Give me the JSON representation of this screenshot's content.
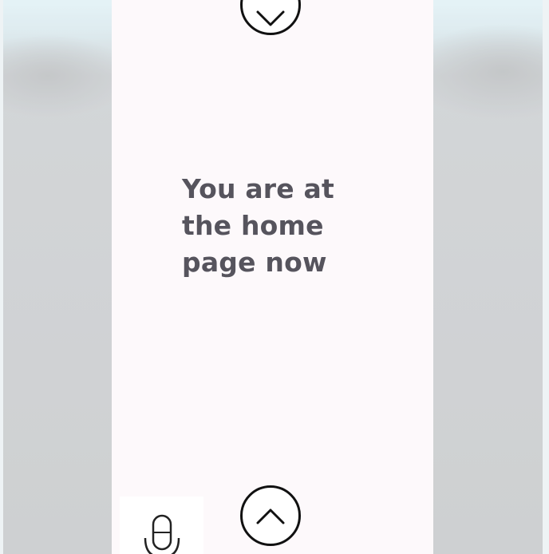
{
  "main": {
    "status_message": "You are at the home page now"
  },
  "controls": {
    "scroll_down_icon": "chevron-down-icon",
    "scroll_up_icon": "chevron-up-icon",
    "voice_icon": "microphone-icon"
  },
  "colors": {
    "panel_background": "#fdf9fb",
    "message_text": "#56545d",
    "icon_stroke": "#111111"
  }
}
